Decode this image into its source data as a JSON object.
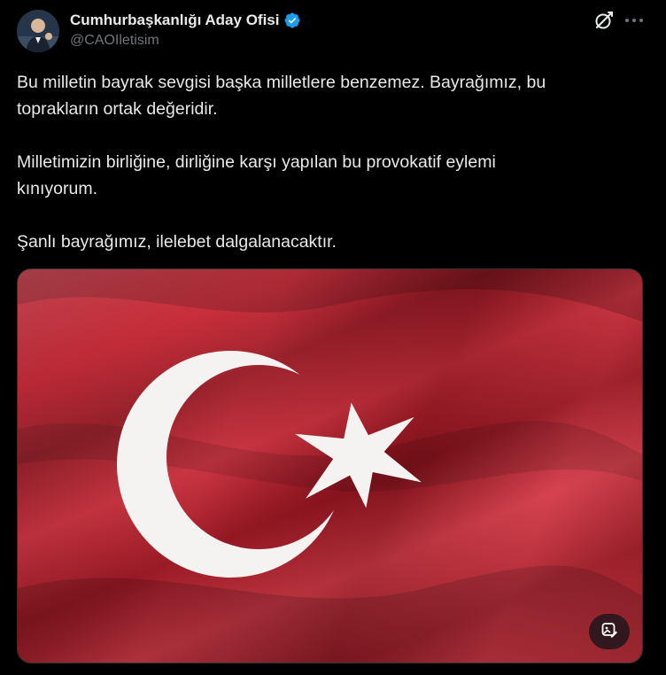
{
  "author": {
    "display_name": "Cumhurbaşkanlığı Aday Ofisi",
    "handle": "@CAOIletisim",
    "verified_color": "#1d9bf0"
  },
  "header_actions": {
    "grok_icon": "grok-icon",
    "more_icon": "more-icon"
  },
  "tweet": {
    "text": "Bu milletin bayrak sevgisi başka milletlere benzemez. Bayrağımız, bu\ntoprakların ortak değeridir.\n\nMilletimizin birliğine, dirliğine karşı yapılan bu provokatif eylemi\nkınıyorum.\n\nŞanlı bayrağımız, ilelebet dalgalanacaktır."
  },
  "media": {
    "subject": "turkish-flag-image",
    "flag_color": "#d81828",
    "emblem_color": "#ffffff",
    "image_action_icon": "image-edit-icon"
  }
}
